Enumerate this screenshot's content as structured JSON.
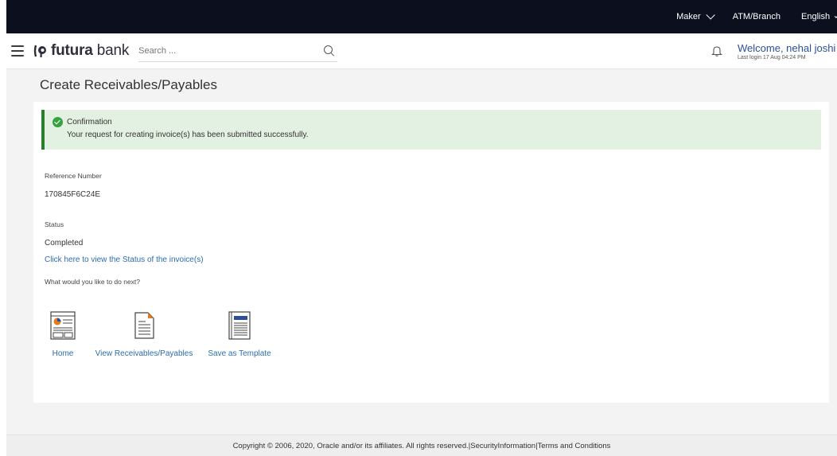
{
  "topbar": {
    "role": "Maker",
    "atm_branch": "ATM/Branch",
    "language": "English"
  },
  "header": {
    "brand_prefix": "futura",
    "brand_suffix": " bank",
    "search_placeholder": "Search ...",
    "welcome": "Welcome, nehal joshi",
    "last_login": "Last login 17 Aug 04:24 PM"
  },
  "page": {
    "title": "Create Receivables/Payables"
  },
  "confirmation": {
    "heading": "Confirmation",
    "message": "Your request for creating invoice(s) has been submitted successfully."
  },
  "details": {
    "reference_label": "Reference Number",
    "reference_value": "170845F6C24E",
    "status_label": "Status",
    "status_value": "Completed",
    "status_link": "Click here to view the Status of the invoice(s)",
    "next_label": "What would you like to do next?"
  },
  "actions": [
    {
      "label": "Home",
      "icon": "dashboard-icon"
    },
    {
      "label": "View Receivables/Payables",
      "icon": "document-icon"
    },
    {
      "label": "Save as Template",
      "icon": "template-icon"
    }
  ],
  "footer": {
    "copyright": "Copyright © 2006, 2020, Oracle and/or its affiliates. All rights reserved.|SecurityInformation|Terms and Conditions"
  }
}
